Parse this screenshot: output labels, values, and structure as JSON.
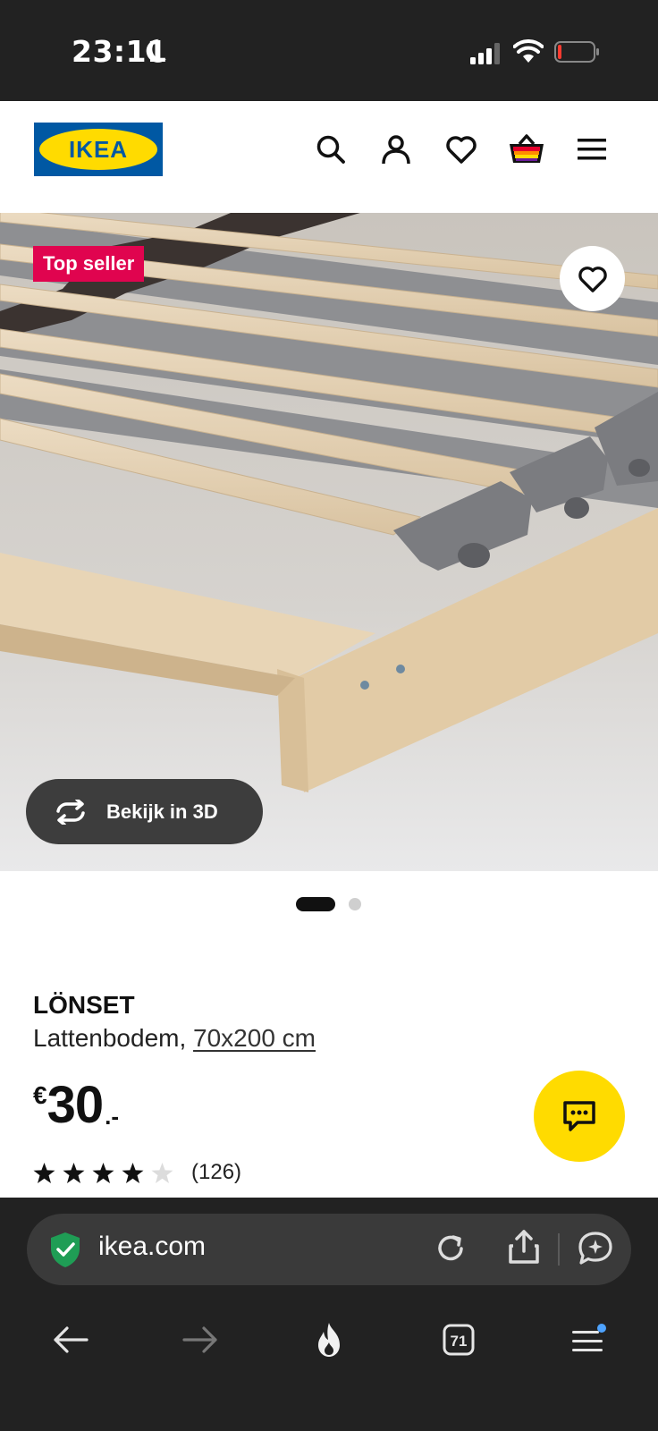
{
  "status_bar": {
    "time": "23:11"
  },
  "header": {
    "logo_text": "IKEA",
    "icons": [
      "search-icon",
      "account-icon",
      "wishlist-heart-icon",
      "shopping-bag-icon",
      "hamburger-menu-icon"
    ]
  },
  "hero": {
    "badge": "Top seller",
    "view_3d_label": "Bekijk in 3D",
    "image_count": 2,
    "active_image": 1
  },
  "product": {
    "name": "LÖNSET",
    "type": "Lattenbodem,",
    "size": "70x200 cm",
    "price": {
      "currency": "€",
      "amount": "30",
      "suffix": ".-"
    },
    "rating": {
      "stars": 4,
      "max": 5,
      "count": "(126)"
    }
  },
  "browser": {
    "url": "ikea.com",
    "tab_count": "71"
  },
  "colors": {
    "ikea_blue": "#0058a3",
    "ikea_yellow": "#ffdb00",
    "badge_red": "#e0044f",
    "chrome_dark": "#222222"
  }
}
